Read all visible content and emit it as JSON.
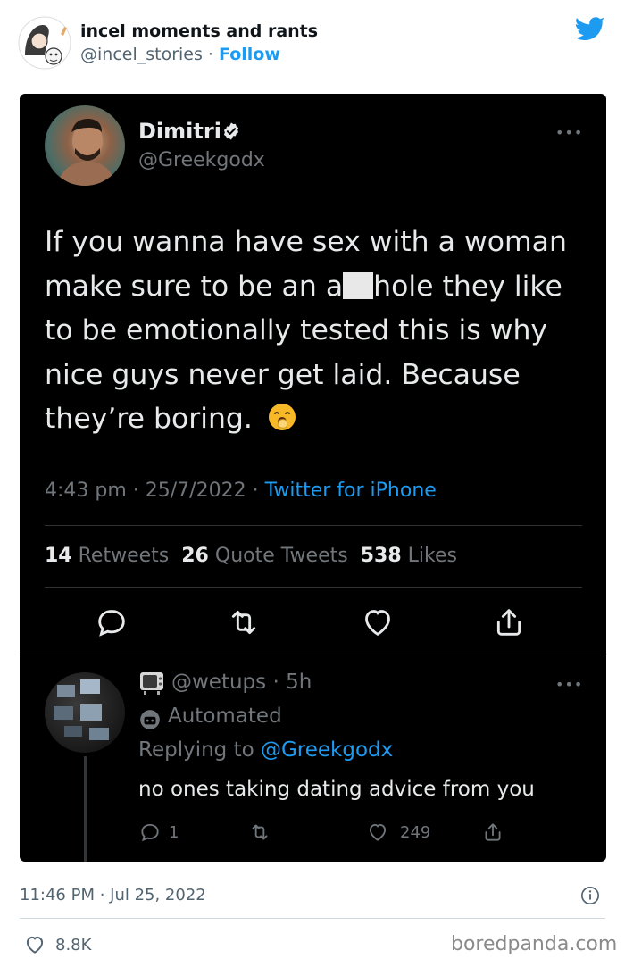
{
  "outer": {
    "account_name": "incel moments and rants",
    "handle": "@incel_stories",
    "separator": " · ",
    "follow_label": "Follow",
    "timestamp": "11:46 PM · Jul 25, 2022",
    "like_count": "8.8K",
    "watermark": "boredpanda.com"
  },
  "tweet": {
    "author_name": "Dimitri",
    "author_handle": "@Greekgodx",
    "text_part1": "If you wanna have sex with a woman make sure to be an a",
    "text_part2": "hole they like to be emotionally tested this is why nice guys never get laid. Because they’re boring.",
    "time": "4:43 pm · 25/7/2022 · ",
    "source": "Twitter for iPhone",
    "retweets_count": "14",
    "retweets_label": "Retweets",
    "quotes_count": "26",
    "quotes_label": "Quote Tweets",
    "likes_count": "538",
    "likes_label": "Likes"
  },
  "reply": {
    "handle_time": "@wetups · 5h",
    "automated_label": "Automated",
    "replying_prefix": "Replying to ",
    "replying_to": "@Greekgodx",
    "text": "no ones taking dating advice from you",
    "reply_count": "1",
    "like_count": "249"
  },
  "colors": {
    "twitter_blue": "#1d9bf0",
    "dark_bg": "#000000",
    "dark_text": "#e7e9ea",
    "dark_muted": "#71767b"
  }
}
